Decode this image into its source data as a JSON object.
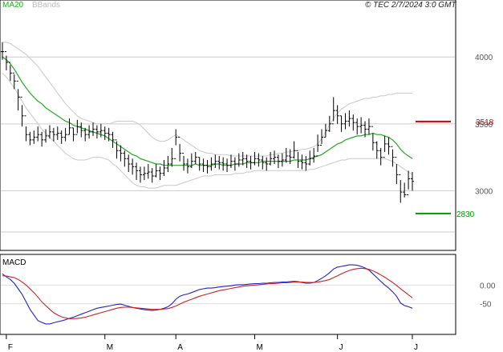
{
  "header": {
    "ma_label": "MA20",
    "bb_label": "BBands",
    "timestamp": "© TEC 2/7/2024 3:0 GMT"
  },
  "colors": {
    "candle": "#000000",
    "ma": "#22aa22",
    "bbands": "#c8c8c8",
    "resistance": "#cc0000",
    "support": "#009900",
    "macd": "#2222cc",
    "signal": "#cc2222"
  },
  "chart_data": [
    {
      "type": "ohlc",
      "title": "",
      "ylim": [
        2560,
        4420
      ],
      "yticks": [
        {
          "value": 4000,
          "label": "4000"
        },
        {
          "value": 3500,
          "label": "3500"
        },
        {
          "value": 3000,
          "label": "3000"
        }
      ],
      "x_labels": [
        {
          "index": 1,
          "label": "F"
        },
        {
          "index": 26,
          "label": "M"
        },
        {
          "index": 44,
          "label": "A"
        },
        {
          "index": 64,
          "label": "M"
        },
        {
          "index": 85,
          "label": "J"
        },
        {
          "index": 104,
          "label": "J"
        }
      ],
      "levels": [
        {
          "name": "resistance",
          "value": 3518,
          "label": "3518"
        },
        {
          "name": "support",
          "value": 2830,
          "label": "2830"
        }
      ],
      "close": [
        4040,
        3960,
        3880,
        3820,
        3700,
        3560,
        3420,
        3380,
        3400,
        3420,
        3380,
        3410,
        3440,
        3420,
        3430,
        3400,
        3420,
        3470,
        3420,
        3480,
        3450,
        3420,
        3440,
        3460,
        3440,
        3450,
        3430,
        3420,
        3380,
        3300,
        3280,
        3240,
        3200,
        3180,
        3150,
        3120,
        3130,
        3140,
        3110,
        3150,
        3130,
        3170,
        3200,
        3240,
        3400,
        3280,
        3200,
        3180,
        3220,
        3250,
        3200,
        3190,
        3180,
        3200,
        3220,
        3210,
        3200,
        3190,
        3220,
        3200,
        3230,
        3240,
        3220,
        3210,
        3240,
        3230,
        3210,
        3200,
        3240,
        3250,
        3220,
        3230,
        3260,
        3250,
        3300,
        3220,
        3210,
        3200,
        3240,
        3260,
        3340,
        3400,
        3450,
        3500,
        3600,
        3560,
        3500,
        3520,
        3540,
        3510,
        3480,
        3490,
        3460,
        3480,
        3360,
        3300,
        3250,
        3350,
        3330,
        3250,
        3120,
        2990,
        2970,
        3090,
        3070
      ],
      "high": [
        4110,
        4010,
        3940,
        3870,
        3760,
        3640,
        3480,
        3440,
        3450,
        3480,
        3440,
        3460,
        3490,
        3470,
        3480,
        3450,
        3470,
        3540,
        3470,
        3530,
        3510,
        3470,
        3490,
        3510,
        3490,
        3500,
        3480,
        3470,
        3440,
        3370,
        3340,
        3300,
        3270,
        3240,
        3210,
        3180,
        3180,
        3200,
        3170,
        3200,
        3180,
        3230,
        3260,
        3320,
        3460,
        3350,
        3260,
        3240,
        3280,
        3290,
        3250,
        3240,
        3230,
        3250,
        3270,
        3260,
        3250,
        3240,
        3270,
        3250,
        3280,
        3290,
        3270,
        3260,
        3290,
        3280,
        3260,
        3250,
        3290,
        3300,
        3270,
        3280,
        3320,
        3310,
        3370,
        3290,
        3270,
        3260,
        3300,
        3320,
        3420,
        3460,
        3500,
        3560,
        3700,
        3640,
        3560,
        3580,
        3600,
        3570,
        3540,
        3550,
        3520,
        3540,
        3430,
        3370,
        3320,
        3410,
        3400,
        3310,
        3200,
        3080,
        3060,
        3150,
        3140
      ],
      "low": [
        3980,
        3900,
        3820,
        3760,
        3600,
        3480,
        3370,
        3340,
        3350,
        3370,
        3330,
        3360,
        3390,
        3370,
        3380,
        3350,
        3370,
        3420,
        3370,
        3430,
        3400,
        3370,
        3390,
        3410,
        3390,
        3400,
        3380,
        3370,
        3320,
        3240,
        3220,
        3180,
        3140,
        3120,
        3080,
        3060,
        3080,
        3090,
        3060,
        3100,
        3080,
        3110,
        3140,
        3180,
        3340,
        3220,
        3150,
        3130,
        3170,
        3200,
        3150,
        3140,
        3130,
        3150,
        3170,
        3160,
        3150,
        3140,
        3170,
        3150,
        3180,
        3190,
        3170,
        3160,
        3190,
        3180,
        3160,
        3150,
        3190,
        3200,
        3170,
        3180,
        3210,
        3200,
        3240,
        3170,
        3160,
        3150,
        3190,
        3210,
        3290,
        3350,
        3400,
        3440,
        3520,
        3500,
        3440,
        3460,
        3480,
        3450,
        3420,
        3430,
        3400,
        3420,
        3300,
        3240,
        3190,
        3290,
        3270,
        3180,
        3050,
        2910,
        2950,
        3010,
        3000
      ],
      "ma20": [
        4000,
        3980,
        3950,
        3910,
        3860,
        3810,
        3770,
        3730,
        3700,
        3670,
        3650,
        3620,
        3600,
        3580,
        3560,
        3540,
        3520,
        3510,
        3490,
        3480,
        3470,
        3460,
        3450,
        3440,
        3430,
        3420,
        3410,
        3390,
        3370,
        3350,
        3330,
        3310,
        3290,
        3270,
        3260,
        3240,
        3230,
        3220,
        3210,
        3200,
        3200,
        3190,
        3190,
        3190,
        3190,
        3190,
        3190,
        3190,
        3190,
        3200,
        3190,
        3190,
        3190,
        3190,
        3200,
        3200,
        3190,
        3190,
        3190,
        3200,
        3200,
        3200,
        3210,
        3210,
        3210,
        3210,
        3220,
        3220,
        3220,
        3220,
        3220,
        3220,
        3220,
        3220,
        3230,
        3230,
        3230,
        3230,
        3240,
        3250,
        3260,
        3270,
        3290,
        3310,
        3330,
        3350,
        3360,
        3380,
        3390,
        3400,
        3410,
        3410,
        3420,
        3420,
        3430,
        3420,
        3420,
        3410,
        3400,
        3380,
        3350,
        3310,
        3280,
        3260,
        3240
      ],
      "bb_upper": [
        4110,
        4110,
        4100,
        4080,
        4060,
        4040,
        4020,
        3990,
        3960,
        3930,
        3890,
        3850,
        3810,
        3770,
        3730,
        3690,
        3650,
        3620,
        3590,
        3560,
        3540,
        3530,
        3520,
        3510,
        3500,
        3500,
        3500,
        3500,
        3510,
        3520,
        3520,
        3520,
        3520,
        3520,
        3510,
        3490,
        3460,
        3430,
        3400,
        3380,
        3370,
        3370,
        3380,
        3400,
        3420,
        3400,
        3380,
        3360,
        3340,
        3320,
        3300,
        3290,
        3280,
        3280,
        3270,
        3270,
        3270,
        3270,
        3260,
        3260,
        3260,
        3260,
        3260,
        3260,
        3260,
        3260,
        3260,
        3260,
        3270,
        3270,
        3280,
        3280,
        3290,
        3290,
        3300,
        3300,
        3310,
        3310,
        3320,
        3330,
        3350,
        3390,
        3440,
        3490,
        3540,
        3580,
        3610,
        3630,
        3650,
        3660,
        3670,
        3680,
        3690,
        3690,
        3700,
        3700,
        3710,
        3710,
        3720,
        3720,
        3730,
        3730,
        3730,
        3730,
        3730
      ],
      "bb_lower": [
        3880,
        3850,
        3810,
        3770,
        3720,
        3670,
        3620,
        3580,
        3540,
        3500,
        3460,
        3430,
        3400,
        3370,
        3340,
        3310,
        3280,
        3260,
        3240,
        3230,
        3230,
        3230,
        3240,
        3250,
        3250,
        3250,
        3240,
        3230,
        3200,
        3180,
        3150,
        3120,
        3090,
        3060,
        3040,
        3030,
        3030,
        3020,
        3020,
        3020,
        3030,
        3040,
        3040,
        3040,
        3040,
        3050,
        3060,
        3070,
        3080,
        3090,
        3100,
        3110,
        3110,
        3110,
        3120,
        3120,
        3120,
        3120,
        3120,
        3130,
        3130,
        3130,
        3140,
        3140,
        3150,
        3150,
        3150,
        3150,
        3150,
        3150,
        3150,
        3150,
        3150,
        3150,
        3150,
        3150,
        3150,
        3150,
        3160,
        3160,
        3170,
        3180,
        3190,
        3200,
        3210,
        3220,
        3230,
        3230,
        3240,
        3240,
        3240,
        3240,
        3240,
        3240,
        3240,
        3240,
        3240,
        3240,
        3230,
        3220,
        3200,
        3180,
        3160,
        3140,
        3120
      ]
    },
    {
      "type": "line",
      "title": "MACD",
      "ylim": [
        -130,
        80
      ],
      "yticks": [
        {
          "value": 0,
          "label": "0.00"
        },
        {
          "value": -50,
          "label": "-50"
        }
      ],
      "series": [
        {
          "name": "macd",
          "values": [
            30,
            22,
            15,
            5,
            -10,
            -25,
            -45,
            -65,
            -80,
            -95,
            -100,
            -104,
            -104,
            -101,
            -98,
            -96,
            -93,
            -89,
            -86,
            -82,
            -78,
            -74,
            -70,
            -66,
            -62,
            -60,
            -58,
            -56,
            -54,
            -52,
            -51,
            -54,
            -57,
            -60,
            -62,
            -64,
            -66,
            -67,
            -68,
            -67,
            -65,
            -62,
            -58,
            -50,
            -38,
            -30,
            -26,
            -24,
            -20,
            -16,
            -12,
            -10,
            -8,
            -8,
            -7,
            -5,
            -4,
            -3,
            -2,
            0,
            1,
            1,
            2,
            3,
            4,
            4,
            5,
            5,
            6,
            7,
            7,
            8,
            8,
            9,
            10,
            9,
            7,
            5,
            5,
            7,
            12,
            18,
            25,
            33,
            43,
            48,
            50,
            52,
            54,
            54,
            53,
            50,
            46,
            40,
            30,
            20,
            10,
            0,
            -8,
            -18,
            -30,
            -48,
            -55,
            -58,
            -62
          ]
        },
        {
          "name": "signal",
          "values": [
            25,
            24,
            22,
            20,
            15,
            8,
            0,
            -10,
            -20,
            -32,
            -45,
            -55,
            -65,
            -74,
            -80,
            -85,
            -88,
            -90,
            -90,
            -89,
            -88,
            -86,
            -83,
            -80,
            -77,
            -74,
            -71,
            -68,
            -65,
            -62,
            -60,
            -59,
            -59,
            -60,
            -61,
            -62,
            -63,
            -64,
            -65,
            -65,
            -65,
            -64,
            -63,
            -60,
            -56,
            -51,
            -46,
            -42,
            -38,
            -34,
            -30,
            -27,
            -24,
            -21,
            -18,
            -15,
            -13,
            -11,
            -9,
            -7,
            -5,
            -3,
            -2,
            -1,
            0,
            1,
            2,
            3,
            4,
            4,
            5,
            6,
            6,
            7,
            8,
            8,
            8,
            7,
            7,
            7,
            8,
            10,
            12,
            15,
            20,
            25,
            30,
            35,
            39,
            42,
            44,
            45,
            44,
            42,
            38,
            33,
            27,
            21,
            14,
            7,
            -1,
            -10,
            -18,
            -26,
            -34
          ]
        }
      ]
    }
  ]
}
